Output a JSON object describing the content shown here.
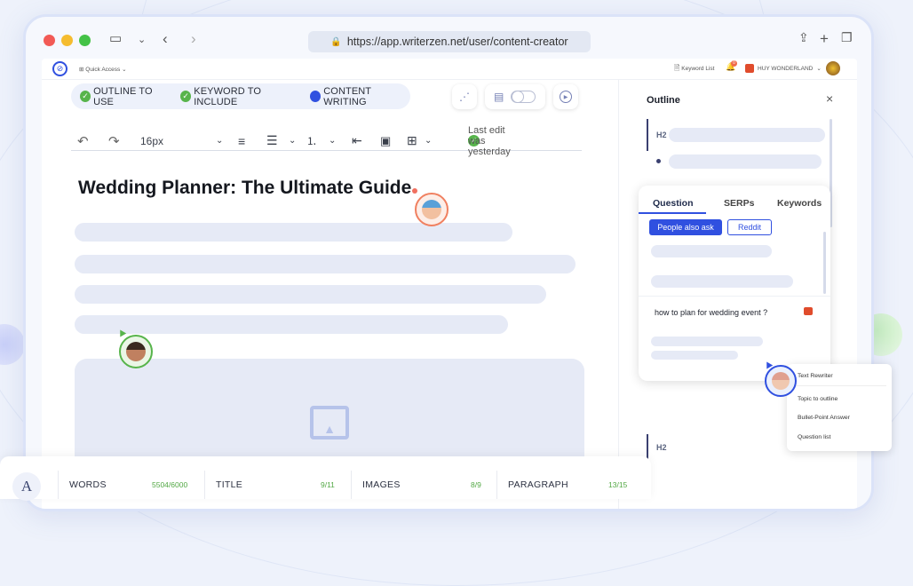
{
  "browser": {
    "url": "https://app.writerzen.net/user/content-creator"
  },
  "topbar": {
    "quick_access": "Quick Access",
    "keyword_list": "Keyword List",
    "notif_count": "0",
    "user": "HUY WONDERLAND"
  },
  "steps": [
    {
      "label": "OUTLINE TO USE",
      "state": "done"
    },
    {
      "label": "KEYWORD TO INCLUDE",
      "state": "done"
    },
    {
      "label": "CONTENT WRITING",
      "state": "active"
    }
  ],
  "toolbar": {
    "font_size": "16px",
    "last_edit": "Last edit was yesterday"
  },
  "doc": {
    "title": "Wedding Planner: The Ultimate Guide"
  },
  "outline": {
    "title": "Outline",
    "close": "×",
    "h2": "H2",
    "h2b": "H2"
  },
  "question_panel": {
    "tabs": [
      "Question",
      "SERPs",
      "Keywords"
    ],
    "filters": [
      "People also ask",
      "Reddit"
    ],
    "question": "how to plan for wedding event ?"
  },
  "context_menu": [
    "Text Rewriter",
    "Topic to outline",
    "Bullet-Point Answer",
    "Question list"
  ],
  "stats": [
    {
      "label": "WORDS",
      "value": "5504/6000"
    },
    {
      "label": "TITLE",
      "value": "9/11"
    },
    {
      "label": "IMAGES",
      "value": "8/9"
    },
    {
      "label": "PARAGRAPH",
      "value": "13/15"
    }
  ],
  "footer_icon": "A",
  "colors": {
    "accent": "#3050e0",
    "check": "#57b44b"
  }
}
